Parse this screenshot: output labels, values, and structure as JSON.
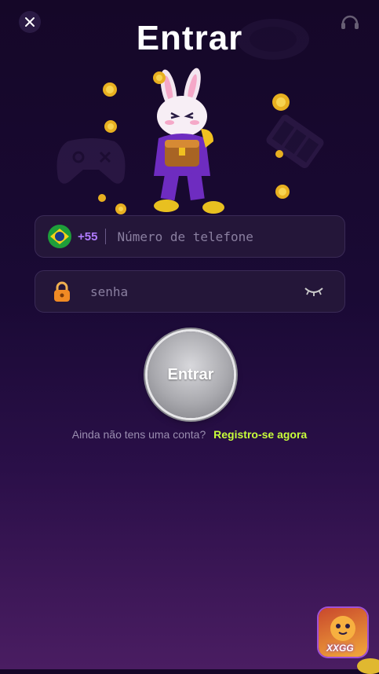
{
  "header": {
    "title": "Entrar"
  },
  "phone": {
    "country_code": "+55",
    "placeholder": "Número de telefone"
  },
  "password": {
    "placeholder": "senha"
  },
  "login_button": {
    "label": "Entrar"
  },
  "register": {
    "prompt": "Ainda não tens uma conta?",
    "link": "Registro-se agora"
  },
  "app_icon": {
    "brand": "XXGG"
  },
  "colors": {
    "accent_link": "#c8ff3a",
    "country_code": "#b07bff",
    "background_top": "#150728",
    "background_bottom": "#4a1d62"
  }
}
